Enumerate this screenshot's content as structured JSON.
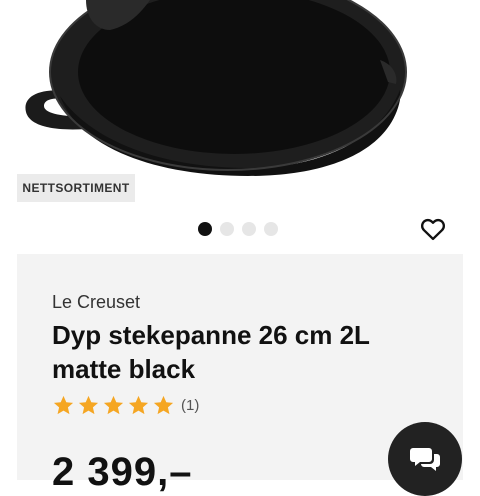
{
  "product": {
    "badge": "NETTSORTIMENT",
    "brand": "Le Creuset",
    "title": "Dyp stekepanne 26 cm 2L matte black",
    "rating": 5,
    "review_count": "(1)",
    "price": "2 399,–"
  },
  "gallery": {
    "image_icon": "cast-iron-pan",
    "slides": 4,
    "active_slide": 1
  },
  "icons": {
    "favorite": "heart-outline-icon",
    "chat": "chat-bubbles-icon",
    "star": "star-icon"
  },
  "colors": {
    "star": "#f5a623",
    "card_bg": "#f3f3f3",
    "badge_bg": "#ebebeb",
    "chat_bg": "#222222"
  }
}
